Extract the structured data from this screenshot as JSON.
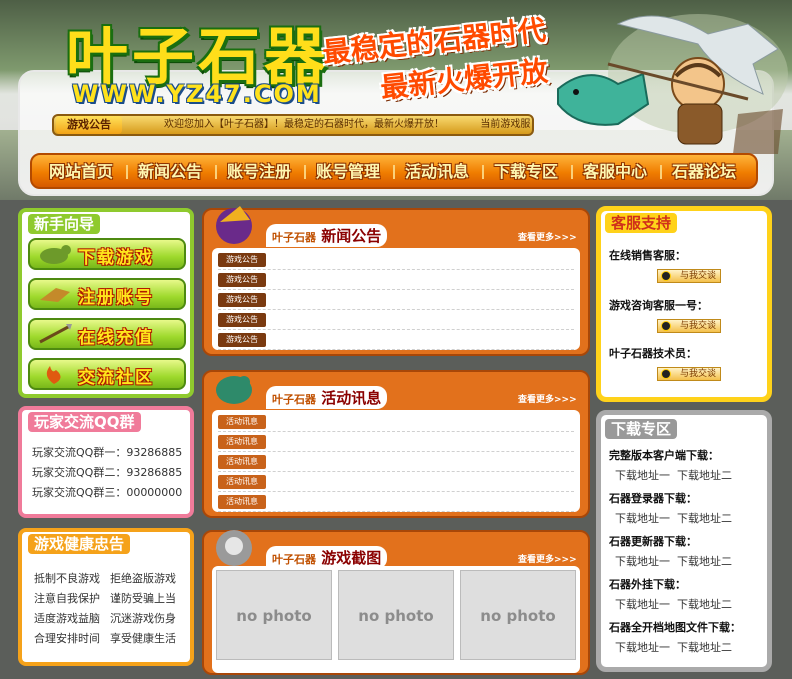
{
  "header": {
    "logo_text": "叶子石器",
    "logo_url": "WWW.YZ47.COM",
    "slogan1": "最稳定的石器时代",
    "slogan2": "最新火爆开放"
  },
  "notice": {
    "tag": "游戏公告",
    "message": "欢迎您加入【叶子石器】！最稳定的石器时代，最新火爆开放！",
    "current": "当前游戏服"
  },
  "nav": {
    "items": [
      "网站首页",
      "新闻公告",
      "账号注册",
      "账号管理",
      "活动讯息",
      "下载专区",
      "客服中心",
      "石器论坛"
    ]
  },
  "guide": {
    "title": "新手向导",
    "buttons": [
      "下载游戏",
      "注册账号",
      "在线充值",
      "交流社区"
    ]
  },
  "qq_groups": {
    "title": "玩家交流QQ群",
    "items": [
      "玩家交流QQ群一：93286885",
      "玩家交流QQ群二：93286885",
      "玩家交流QQ群三：00000000"
    ]
  },
  "health": {
    "title": "游戏健康忠告",
    "rows": [
      [
        "抵制不良游戏",
        "拒绝盗版游戏"
      ],
      [
        "注意自我保护",
        "谨防受骗上当"
      ],
      [
        "适度游戏益脑",
        "沉迷游戏伤身"
      ],
      [
        "合理安排时间",
        "享受健康生活"
      ]
    ]
  },
  "news": {
    "brand": "叶子石器",
    "title": "新闻公告",
    "more": "查看更多>>>",
    "tag": "游戏公告"
  },
  "events": {
    "brand": "叶子石器",
    "title": "活动讯息",
    "more": "查看更多>>>",
    "tag": "活动讯息"
  },
  "screens": {
    "brand": "叶子石器",
    "title": "游戏截图",
    "more": "查看更多>>>",
    "photos": [
      "no photo",
      "no photo",
      "no photo"
    ]
  },
  "support": {
    "title": "客服支持",
    "items": [
      "在线销售客服：",
      "游戏咨询客服一号：",
      "叶子石器技术员："
    ],
    "qq_label": "与我交谈"
  },
  "downloads": {
    "title": "下载专区",
    "groups": [
      {
        "head": "完整版本客户端下载：",
        "links": [
          "下载地址一",
          "下载地址二"
        ]
      },
      {
        "head": "石器登录器下载：",
        "links": [
          "下载地址一",
          "下载地址二"
        ]
      },
      {
        "head": "石器更新器下载：",
        "links": [
          "下载地址一",
          "下载地址二"
        ]
      },
      {
        "head": "石器外挂下载：",
        "links": [
          "下载地址一",
          "下载地址二"
        ]
      },
      {
        "head": "石器全开档地图文件下载：",
        "links": [
          "下载地址一",
          "下载地址二"
        ]
      }
    ]
  },
  "colors": {
    "nav": "#f07d00",
    "guide_border": "#8fca2e",
    "qq_border": "#f07b9a",
    "health_border": "#f5a21a",
    "support_border": "#ffd21a",
    "download_border": "#aaaaaa"
  }
}
